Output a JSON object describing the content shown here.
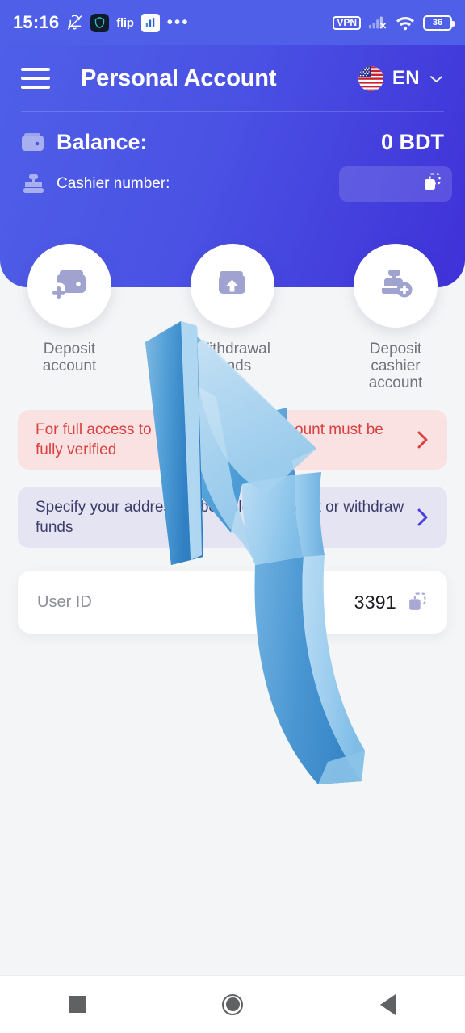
{
  "statusbar": {
    "time": "15:16",
    "icons_left": [
      "bell-muted-icon",
      "shield-icon",
      "flip-label",
      "chart-app-icon",
      "overflow-dots-icon"
    ],
    "flip_label": "flip",
    "vpn_label": "VPN",
    "battery_percent": "36",
    "icons_right": [
      "vpn-badge",
      "signal-no-sim-icon",
      "wifi-icon",
      "battery-icon"
    ]
  },
  "header": {
    "menu_icon": "hamburger-menu-icon",
    "title": "Personal Account",
    "language": {
      "flag": "us-flag-icon",
      "code": "EN",
      "chevron": "chevron-down-icon"
    },
    "balance": {
      "icon": "wallet-icon",
      "label": "Balance:",
      "value": "0 BDT"
    },
    "cashier": {
      "icon": "cash-register-icon",
      "label": "Cashier number:",
      "value": "",
      "copy_icon": "copy-icon"
    }
  },
  "actions": [
    {
      "icon": "wallet-plus-icon",
      "label": "Deposit\naccount"
    },
    {
      "icon": "wallet-upload-icon",
      "label": "Withdrawal\nfunds"
    },
    {
      "icon": "cash-register-plus-icon",
      "label": "Deposit\ncashier\naccount"
    }
  ],
  "banners": [
    {
      "text": "For full access to all functions, the account must be fully verified",
      "arrow": "chevron-right-icon",
      "type": "warning"
    },
    {
      "text": "Specify your address to be able to deposit or withdraw funds",
      "arrow": "chevron-right-icon",
      "type": "info"
    }
  ],
  "user_id": {
    "label": "User ID",
    "value": "3391",
    "copy_icon": "copy-icon"
  },
  "navbar": [
    {
      "icon": "recents-square-icon"
    },
    {
      "icon": "home-circle-icon"
    },
    {
      "icon": "back-triangle-icon"
    }
  ],
  "overlay": {
    "graphic": "curved-3d-arrow-pointing-up-left"
  },
  "colors": {
    "header_start": "#4f5fe8",
    "header_end": "#3f31d8",
    "page_bg": "#f4f5f6",
    "warning_bg": "#fae2e2",
    "warning_fg": "#d94040",
    "info_bg": "#e5e4f3",
    "info_fg": "#3c3d68",
    "accent": "#4a3fe0",
    "icon_muted": "#9b9dce",
    "arrow_light": "#a8d4f0",
    "arrow_dark": "#3f8fd0"
  }
}
